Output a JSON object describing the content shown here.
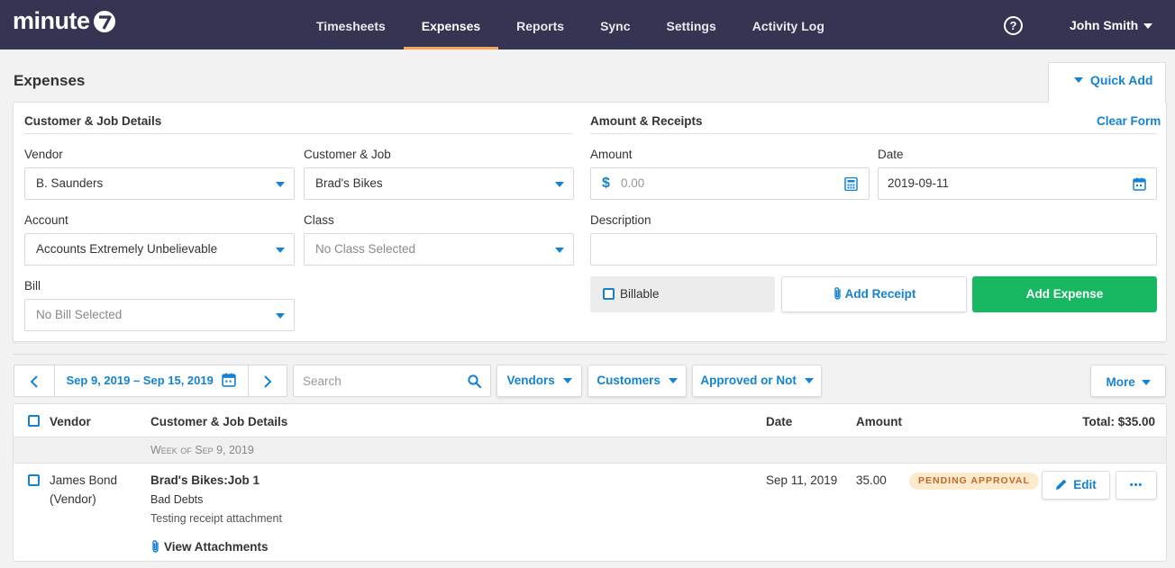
{
  "app": {
    "logo_text": "minute"
  },
  "nav": {
    "items": [
      {
        "label": "Timesheets"
      },
      {
        "label": "Expenses"
      },
      {
        "label": "Reports"
      },
      {
        "label": "Sync"
      },
      {
        "label": "Settings"
      },
      {
        "label": "Activity Log"
      }
    ],
    "active": "Expenses",
    "help_glyph": "?",
    "user_name": "John Smith"
  },
  "page": {
    "title": "Expenses",
    "quick_add": "Quick Add"
  },
  "form": {
    "customer_section": {
      "title": "Customer & Job Details",
      "vendor_label": "Vendor",
      "vendor_value": "B. Saunders",
      "customer_label": "Customer & Job",
      "customer_value": "Brad's Bikes",
      "account_label": "Account",
      "account_value": "Accounts Extremely Unbelievable",
      "class_label": "Class",
      "class_value": "No Class Selected",
      "bill_label": "Bill",
      "bill_value": "No Bill Selected"
    },
    "amount_section": {
      "title": "Amount & Receipts",
      "clear_form": "Clear Form",
      "amount_label": "Amount",
      "amount_currency": "$",
      "amount_placeholder": "0.00",
      "date_label": "Date",
      "date_value": "2019-09-11",
      "description_label": "Description",
      "description_value": "",
      "billable_label": "Billable",
      "add_receipt": "Add Receipt",
      "add_expense": "Add Expense"
    }
  },
  "filters": {
    "date_range": "Sep 9, 2019 – Sep 15, 2019",
    "search_placeholder": "Search",
    "vendors": "Vendors",
    "customers": "Customers",
    "approval": "Approved or Not",
    "more": "More"
  },
  "table": {
    "headers": {
      "vendor": "Vendor",
      "details": "Customer & Job Details",
      "date": "Date",
      "amount": "Amount",
      "total": "Total: $35.00"
    },
    "group_label": "Week of Sep 9, 2019",
    "rows": [
      {
        "vendor_name": "James Bond",
        "vendor_type": "(Vendor)",
        "job": "Brad's Bikes:Job 1",
        "account": "Bad Debts",
        "note": "Testing receipt attachment",
        "attachments_link": "View Attachments",
        "date": "Sep 11, 2019",
        "amount": "35.00",
        "status": "PENDING APPROVAL",
        "edit": "Edit",
        "more": "•••"
      }
    ]
  },
  "colors": {
    "topbar": "#353553",
    "accent": "#1582d1",
    "active_tab_underline": "#f2a65a",
    "add_expense": "#17b861",
    "pending_badge_bg": "#fdeacc",
    "pending_badge_text": "#c0682a"
  },
  "icons": [
    "help-icon",
    "chevron-down-icon",
    "calculator-icon",
    "calendar-icon",
    "chevron-left-icon",
    "chevron-right-icon",
    "search-icon",
    "paperclip-icon",
    "pencil-icon",
    "ellipsis-icon"
  ]
}
